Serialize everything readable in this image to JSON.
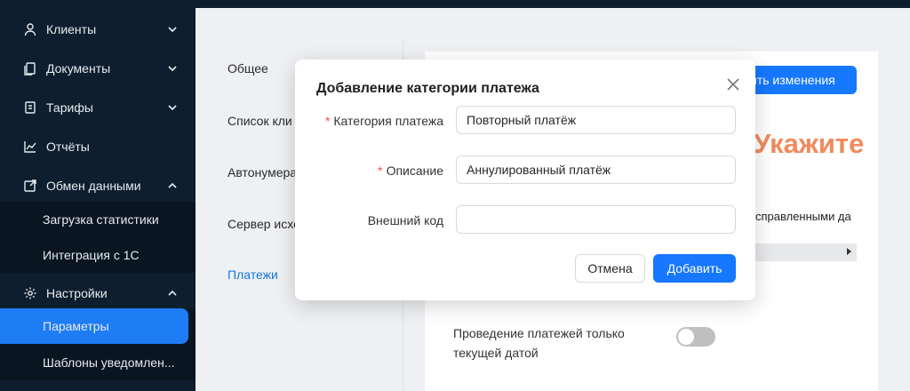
{
  "sidebar": {
    "items": [
      {
        "label": "Клиенты",
        "icon": "user-icon"
      },
      {
        "label": "Документы",
        "icon": "documents-icon"
      },
      {
        "label": "Тарифы",
        "icon": "tariff-icon"
      },
      {
        "label": "Отчёты",
        "icon": "chart-icon"
      },
      {
        "label": "Обмен данными",
        "icon": "exchange-icon"
      }
    ],
    "exchange_sub": [
      "Загрузка статистики",
      "Интеграция с 1С"
    ],
    "settings": {
      "label": "Настройки",
      "icon": "gear-icon"
    },
    "settings_sub": [
      "Параметры",
      "Шаблоны уведомлен..."
    ]
  },
  "settings_nav": [
    "Общее",
    "Список кли",
    "Автонумера",
    "Сервер исхо",
    "Платежи"
  ],
  "background": {
    "save_button": "ить изменения",
    "column_text": "справленными да",
    "toggle_label": "Проведение платежей только текущей датой"
  },
  "annotation": {
    "text": "Укажите",
    "color": "#f08a5d"
  },
  "modal": {
    "title": "Добавление категории платежа",
    "fields": [
      {
        "label": "Категория платежа",
        "required": true,
        "value": "Повторный платёж"
      },
      {
        "label": "Описание",
        "required": true,
        "value": "Аннулированный платёж"
      },
      {
        "label": "Внешний код",
        "required": false,
        "value": ""
      }
    ],
    "cancel_label": "Отмена",
    "add_label": "Добавить"
  },
  "colors": {
    "accent": "#1677ff",
    "sidebar_bg": "#0f1e2e",
    "required": "#ff4d4f"
  }
}
